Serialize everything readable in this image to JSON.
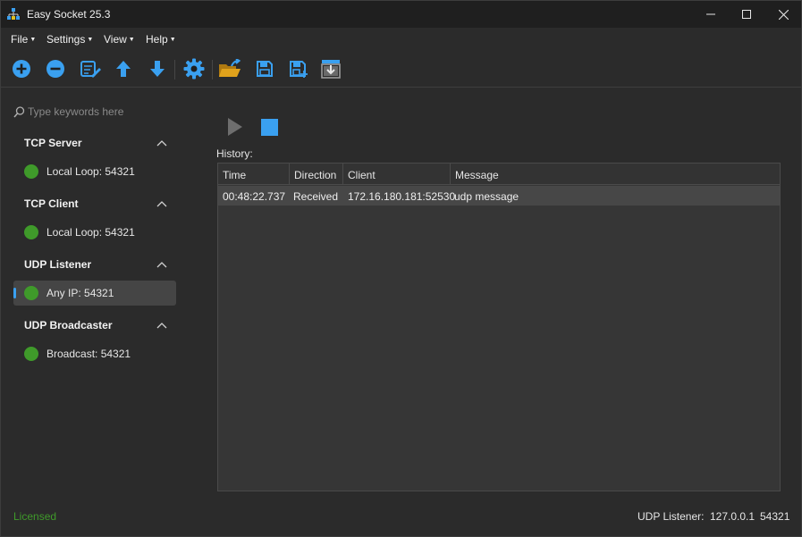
{
  "window": {
    "title": "Easy Socket 25.3"
  },
  "menu": {
    "items": [
      "File",
      "Settings",
      "View",
      "Help"
    ]
  },
  "toolbar": {
    "icons": [
      "add-icon",
      "remove-icon",
      "edit-icon",
      "move-up-icon",
      "move-down-icon",
      "settings-icon",
      "open-folder-icon",
      "save-icon",
      "save-as-icon",
      "export-icon"
    ]
  },
  "sidebar": {
    "search_placeholder": "Type keywords here",
    "groups": [
      {
        "title": "TCP Server",
        "items": [
          {
            "label": "Local Loop: 54321",
            "status": "connected"
          }
        ]
      },
      {
        "title": "TCP Client",
        "items": [
          {
            "label": "Local Loop: 54321",
            "status": "connected"
          }
        ]
      },
      {
        "title": "UDP Listener",
        "items": [
          {
            "label": "Any IP: 54321",
            "status": "connected",
            "selected": true
          }
        ]
      },
      {
        "title": "UDP Broadcaster",
        "items": [
          {
            "label": "Broadcast: 54321",
            "status": "connected"
          }
        ]
      }
    ]
  },
  "main": {
    "history_label": "History:",
    "columns": [
      "Time",
      "Direction",
      "Client",
      "Message"
    ],
    "rows": [
      {
        "time": "00:48:22.737",
        "direction": "Received",
        "client": "172.16.180.181:52530",
        "message": "udp message"
      }
    ]
  },
  "status": {
    "license": "Licensed",
    "connection_type": "UDP Listener:",
    "address": "127.0.0.1",
    "port": "54321"
  },
  "colors": {
    "accent": "#3aa0f0",
    "status_green": "#3f9a2a",
    "background": "#2b2b2b",
    "toolbar_icon": "#3aa0f0",
    "folder": "#e0a21c"
  }
}
